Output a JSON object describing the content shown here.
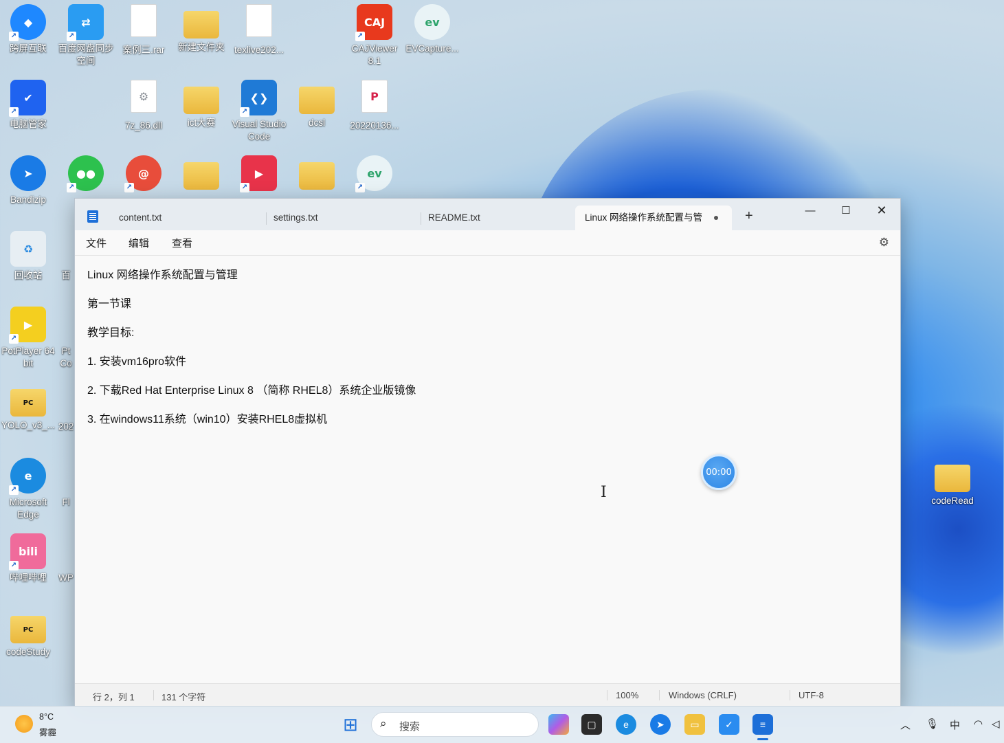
{
  "desktop": {
    "icons": [
      {
        "label": "跨屏互联",
        "name": "desktop-icon-kuaping",
        "color": "#1e88ff"
      },
      {
        "label": "百度网盘同步空间",
        "name": "desktop-icon-baidu-sync",
        "color": "#2a9cf2"
      },
      {
        "label": "案例三.rar",
        "name": "desktop-icon-case-rar",
        "color": "#ffffff"
      },
      {
        "label": "新建文件夹",
        "name": "desktop-icon-new-folder",
        "color": "#f2c94c"
      },
      {
        "label": "texlive202...",
        "name": "desktop-icon-texlive",
        "color": "#ffffff"
      },
      {
        "label": "CAJViewer 8.1",
        "name": "desktop-icon-cajviewer",
        "color": "#e8391d"
      },
      {
        "label": "EVCapture...",
        "name": "desktop-icon-evcapture",
        "color": "#e9f3f6"
      },
      {
        "label": "电脑管家",
        "name": "desktop-icon-pc-manager",
        "color": "#1f63f0"
      },
      {
        "label": "7z_86.dll",
        "name": "desktop-icon-7z-dll",
        "color": "#ffffff"
      },
      {
        "label": "ict大赛",
        "name": "desktop-icon-ict-folder",
        "color": "#f2c94c"
      },
      {
        "label": "Visual Studio Code",
        "name": "desktop-icon-vscode",
        "color": "#1f7ad6"
      },
      {
        "label": "dcsl",
        "name": "desktop-icon-dcsl-folder",
        "color": "#f2c94c"
      },
      {
        "label": "20220136...",
        "name": "desktop-icon-pdf",
        "color": "#ffffff"
      },
      {
        "label": "Bandizip",
        "name": "desktop-icon-bandizip",
        "color": "#1a7be6"
      },
      {
        "label": "回收站",
        "name": "desktop-icon-recycle-bin",
        "color": "#e7eef3"
      },
      {
        "label": "PotPlayer 64 bit",
        "name": "desktop-icon-potplayer",
        "color": "#f4cf1f"
      },
      {
        "label": "YOLO_v3_...",
        "name": "desktop-icon-yolo-folder",
        "color": "#f2c94c"
      },
      {
        "label": "Microsoft Edge",
        "name": "desktop-icon-edge",
        "color": "#1b8be0"
      },
      {
        "label": "哔哩哔哩",
        "name": "desktop-icon-bilibili",
        "color": "#f06b9b"
      },
      {
        "label": "codeStudy",
        "name": "desktop-icon-codestudy-folder",
        "color": "#f2c94c"
      },
      {
        "label": "codeRead",
        "name": "desktop-icon-coderead-folder",
        "color": "#f2c94c"
      }
    ],
    "partial_labels": [
      "百",
      "Pt Co",
      "202",
      "Fl",
      "WP"
    ]
  },
  "notepad": {
    "tabs": [
      {
        "label": "content.txt"
      },
      {
        "label": "settings.txt"
      },
      {
        "label": "README.txt"
      },
      {
        "label": "Linux 网络操作系统配置与管"
      }
    ],
    "new_tab": "+",
    "menu": {
      "file": "文件",
      "edit": "编辑",
      "view": "查看"
    },
    "content_lines": [
      "Linux 网络操作系统配置与管理",
      "第一节课",
      "教学目标:",
      "1. 安装vm16pro软件",
      "2. 下载Red Hat Enterprise Linux 8 （简称 RHEL8）系统企业版镜像",
      "3. 在windows11系统（win10）安装RHEL8虚拟机"
    ],
    "status": {
      "position": "行 2，列 1",
      "chars": "131 个字符",
      "zoom": "100%",
      "line_ending": "Windows (CRLF)",
      "encoding": "UTF-8"
    }
  },
  "recorder": {
    "timer": "00:00"
  },
  "taskbar": {
    "weather_temp": "8°C",
    "weather_desc": "雾霾",
    "search_placeholder": "搜索",
    "ime": "中"
  }
}
